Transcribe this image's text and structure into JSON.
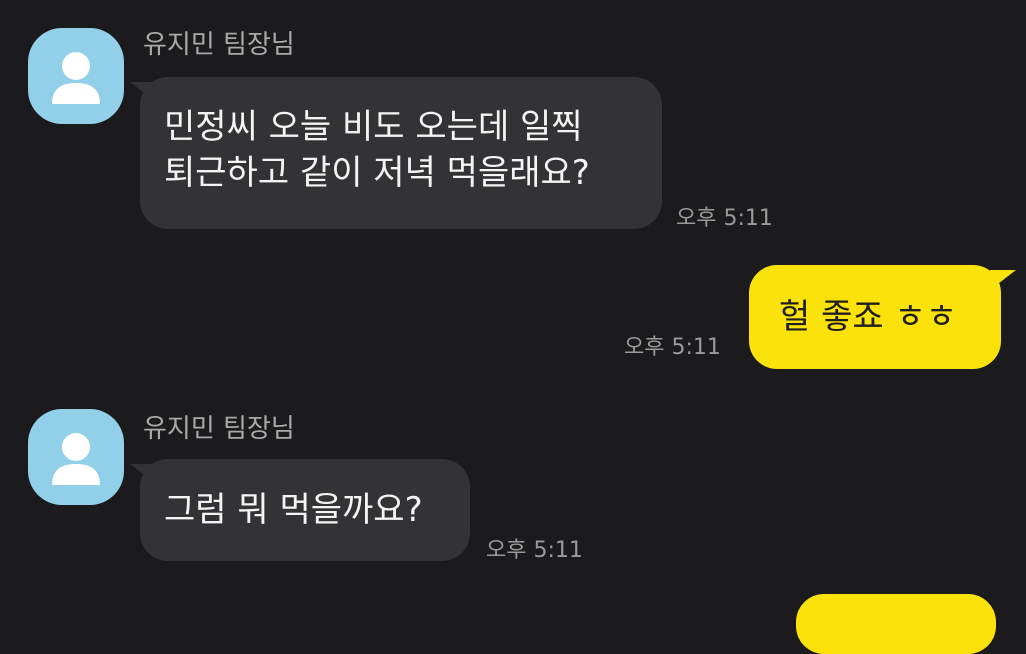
{
  "chat": {
    "messages": [
      {
        "sender": "유지민 팀장님",
        "lines": [
          "민정씨 오늘 비도 오는데 일찍",
          "퇴근하고 같이 저녁 먹을래요?"
        ],
        "time": "오후 5:11"
      },
      {
        "sender": "",
        "lines": [
          "헐 좋죠 ㅎㅎ"
        ],
        "time": "오후 5:11"
      },
      {
        "sender": "유지민 팀장님",
        "lines": [
          "그럼 뭐 먹을까요?"
        ],
        "time": "오후 5:11"
      }
    ]
  },
  "colors": {
    "background": "#1b1b1d",
    "incoming_bubble": "#333336",
    "outgoing_bubble": "#fbe20a",
    "avatar": "#92cfe8",
    "timestamp": "#9a9a9a"
  },
  "icons": {
    "avatar": "default-profile-icon"
  }
}
